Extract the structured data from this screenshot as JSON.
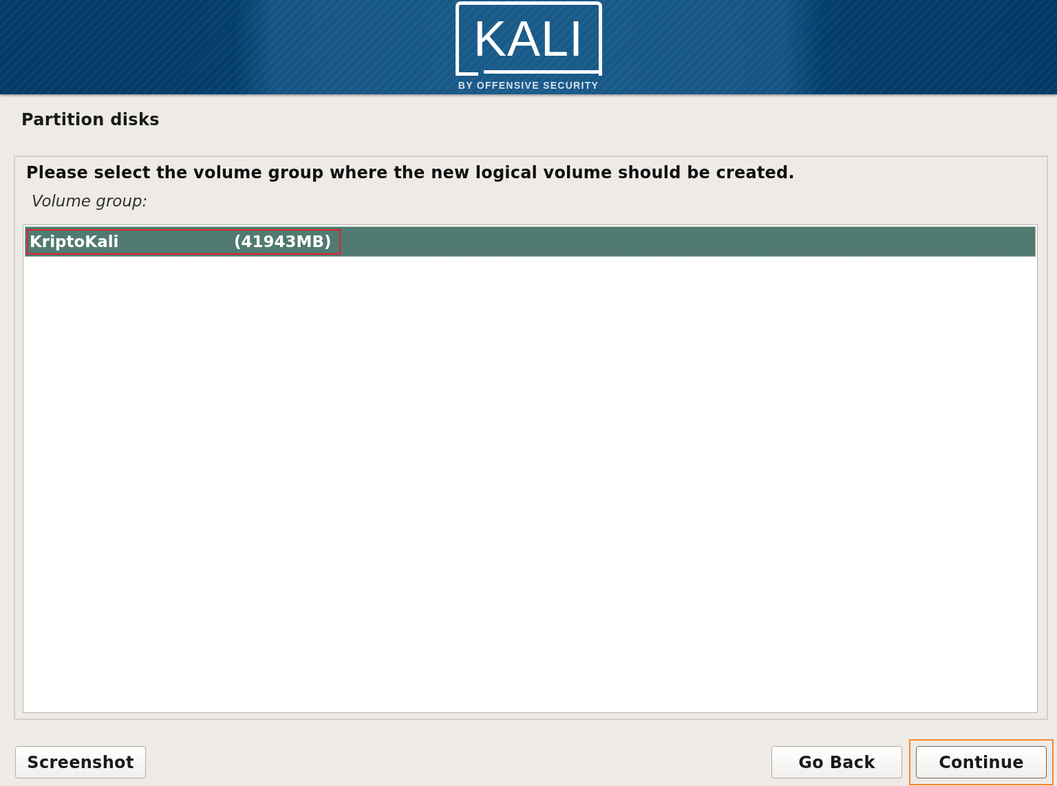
{
  "header": {
    "logo_text": "KALI",
    "logo_tagline": "BY OFFENSIVE SECURITY"
  },
  "title": "Partition disks",
  "question": "Please select the volume group where the new logical volume should be created.",
  "list_label": "Volume group:",
  "volume_groups": [
    {
      "name": "KriptoKali",
      "size": "(41943MB)",
      "selected": true,
      "highlighted": true
    }
  ],
  "buttons_left": [
    {
      "label": "Screenshot",
      "focused": false,
      "highlighted": false
    }
  ],
  "buttons_right": [
    {
      "label": "Go Back",
      "focused": false,
      "highlighted": false
    },
    {
      "label": "Continue",
      "focused": true,
      "highlighted": true
    }
  ]
}
